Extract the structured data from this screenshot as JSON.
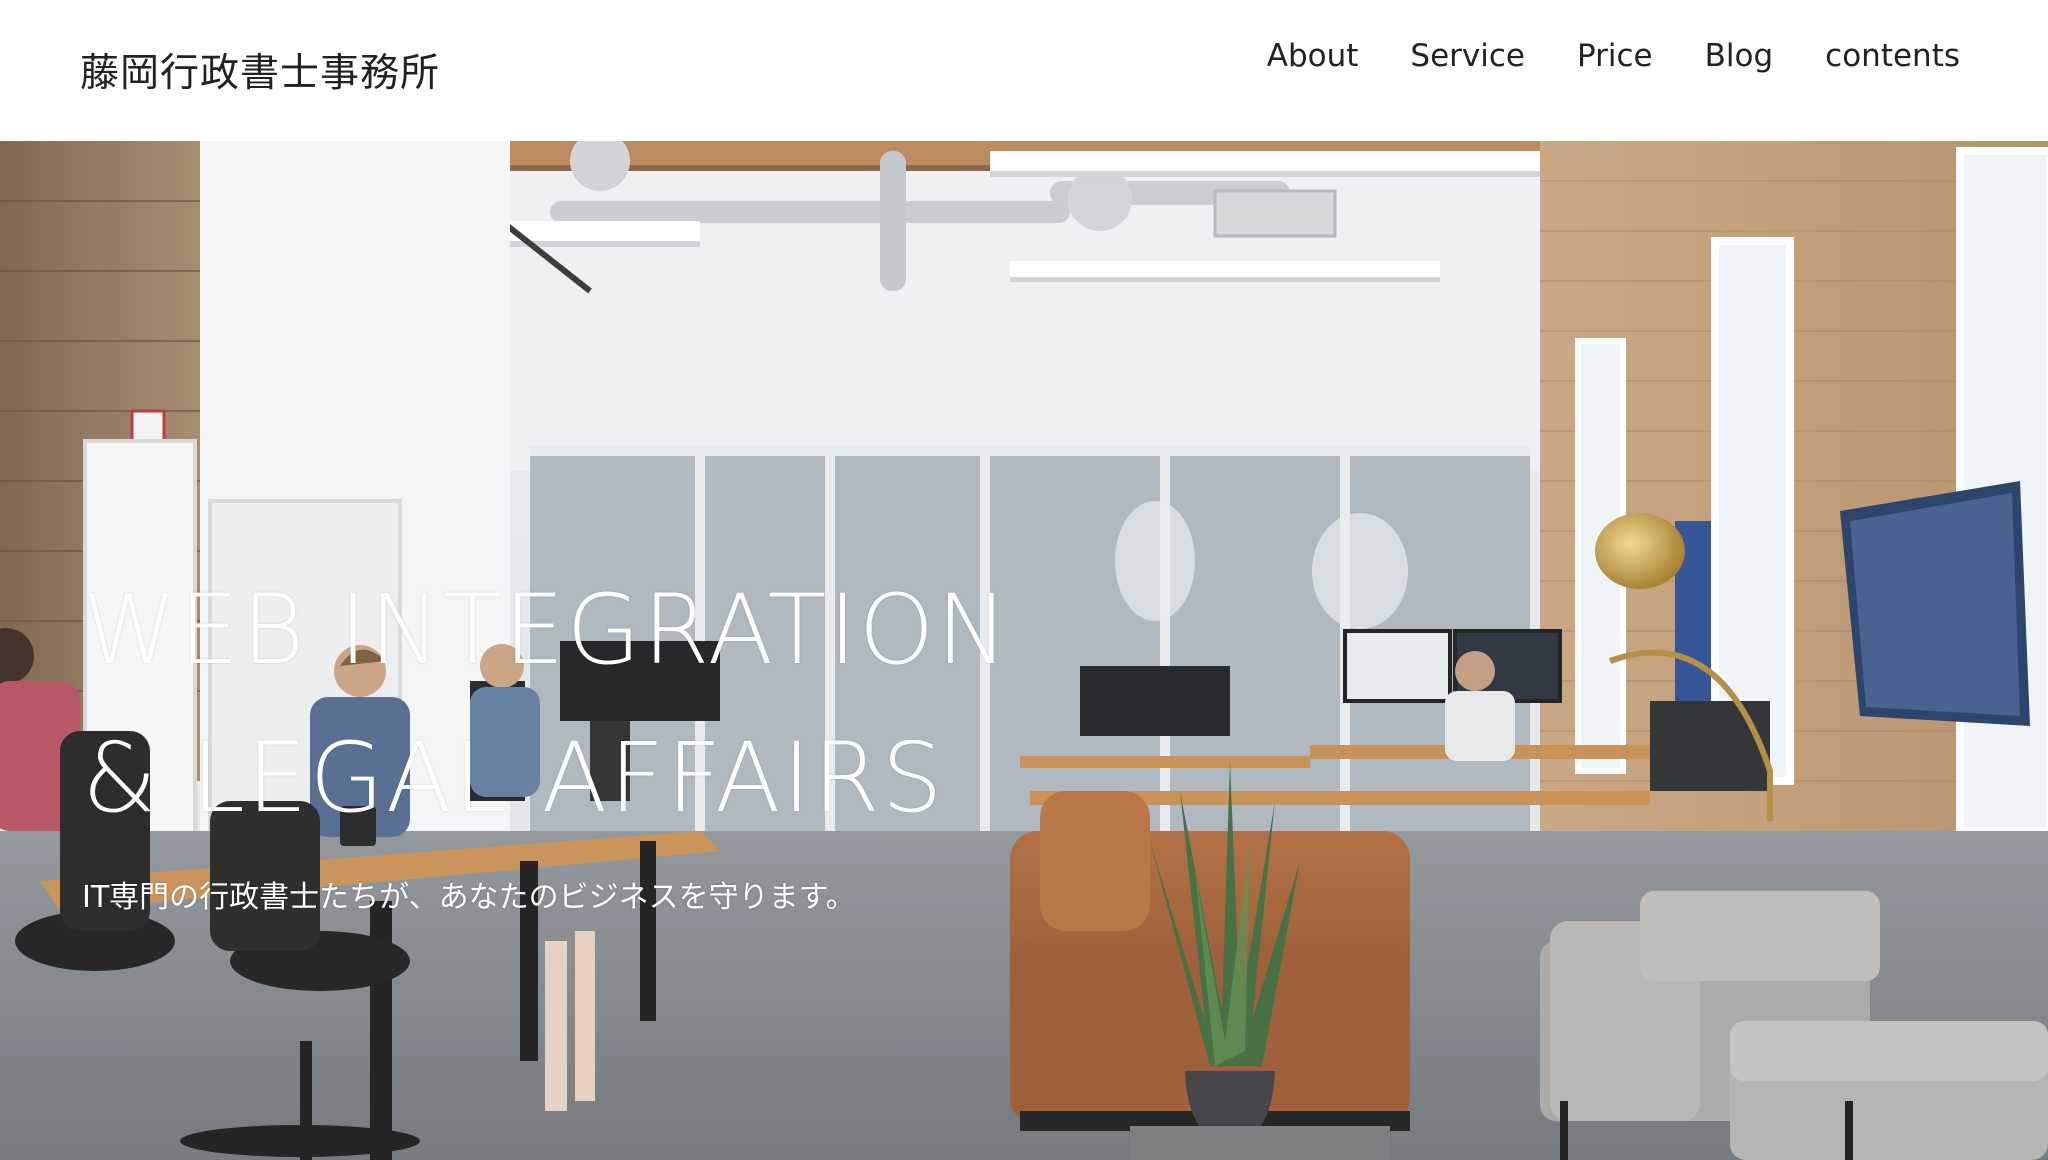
{
  "header": {
    "site_title": "藤岡行政書士事務所",
    "nav": [
      {
        "label": "About"
      },
      {
        "label": "Service"
      },
      {
        "label": "Price"
      },
      {
        "label": "Blog"
      },
      {
        "label": "contents"
      }
    ]
  },
  "hero": {
    "title_line_1": "WEB INTEGRATION",
    "title_line_2": "& LEGAL AFFAIRS",
    "subtitle": "IT専門の行政書士たちが、あなたのビジネスを守ります。"
  },
  "colors": {
    "header_bg": "#ffffff",
    "text_dark": "#222222",
    "hero_text": "#ffffff"
  }
}
